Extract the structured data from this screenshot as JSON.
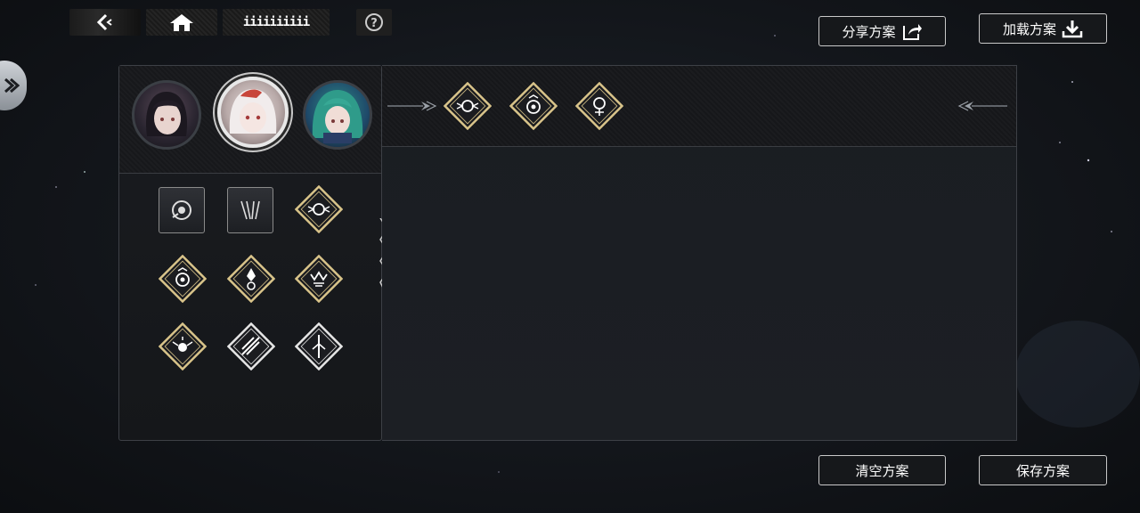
{
  "topbar": {
    "title": "iiiiiiiiii",
    "back_icon": "back-arrow-icon",
    "home_icon": "home-icon",
    "help_icon": "help-icon"
  },
  "buttons": {
    "share": "分享方案",
    "load": "加载方案",
    "clear": "清空方案",
    "save": "保存方案"
  },
  "characters": [
    {
      "name": "character-1"
    },
    {
      "name": "character-2",
      "selected": true
    },
    {
      "name": "character-3"
    }
  ],
  "skills": [
    {
      "shape": "square",
      "icon": "eye-orb-icon"
    },
    {
      "shape": "square",
      "icon": "claws-icon"
    },
    {
      "shape": "diamond",
      "border": "gold",
      "icon": "winged-orb-icon"
    },
    {
      "shape": "diamond",
      "border": "gold",
      "icon": "shield-eye-icon"
    },
    {
      "shape": "diamond",
      "border": "gold",
      "icon": "crystal-icon"
    },
    {
      "shape": "diamond",
      "border": "gold",
      "icon": "crowned-cup-icon"
    },
    {
      "shape": "diamond",
      "border": "gold",
      "icon": "winged-orb-icon"
    },
    {
      "shape": "diamond",
      "border": "silver",
      "icon": "spear-burst-icon"
    },
    {
      "shape": "diamond",
      "border": "silver",
      "icon": "spear-staff-icon"
    }
  ],
  "selected_skills": [
    {
      "border": "gold",
      "icon": "winged-orb-icon"
    },
    {
      "border": "gold",
      "icon": "shield-eye-icon"
    },
    {
      "border": "gold",
      "icon": "flower-orb-icon"
    }
  ],
  "colors": {
    "gold": "#d9c48a",
    "silver": "#e6e6e6"
  }
}
